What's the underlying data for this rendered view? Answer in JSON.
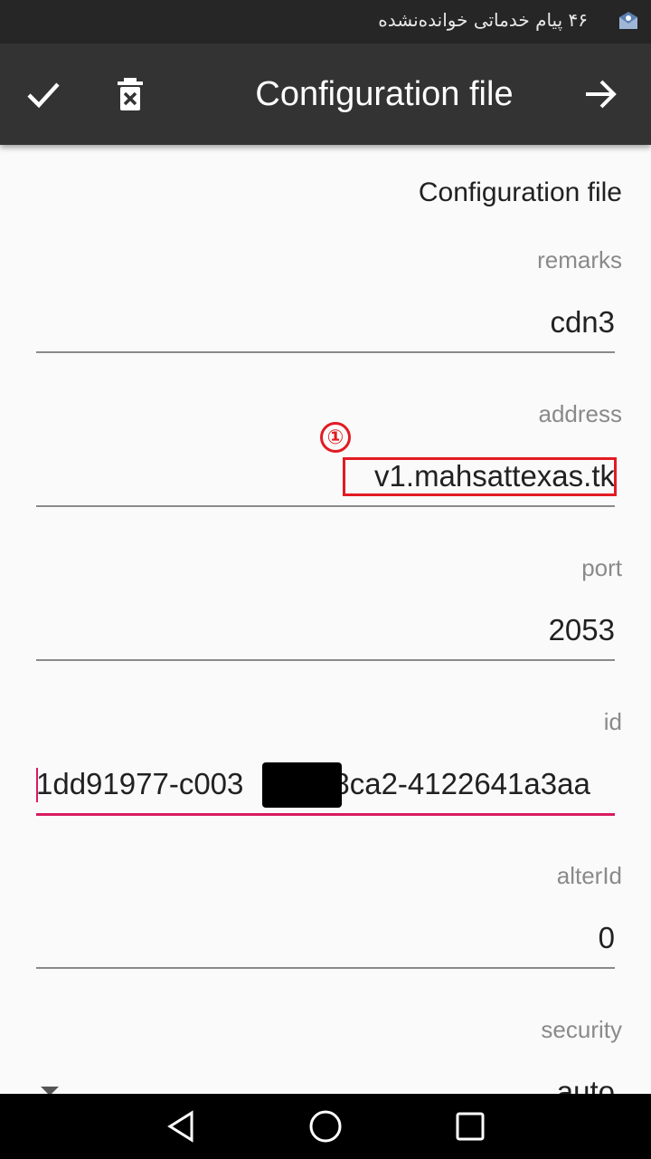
{
  "status_bar": {
    "notification_text": "۴۶ پیام خدماتی خوانده‌نشده",
    "icon": "mail-notification-icon"
  },
  "toolbar": {
    "title": "Configuration file",
    "confirm_icon": "check-icon",
    "delete_icon": "delete-icon",
    "forward_icon": "arrow-right-icon"
  },
  "form": {
    "section_title": "Configuration file",
    "fields": {
      "remarks": {
        "label": "remarks",
        "value": "cdn3"
      },
      "address": {
        "label": "address",
        "value": "v1.mahsattexas.tk"
      },
      "port": {
        "label": "port",
        "value": "2053"
      },
      "id": {
        "label": "id",
        "value": "1dd91977-c003",
        "value_after_redaction": "-8ca2-4122641a3aa"
      },
      "alterId": {
        "label": "alterId",
        "value": "0"
      },
      "security": {
        "label": "security",
        "value": "auto"
      }
    }
  },
  "annotation": {
    "marker": "①",
    "color": "#e21b23"
  },
  "colors": {
    "toolbar": "#333333",
    "status_bar": "#262626",
    "accent": "#d81b60",
    "background": "#fafafa"
  },
  "nav_bar": {
    "back_icon": "back-triangle-icon",
    "home_icon": "home-circle-icon",
    "recents_icon": "recents-square-icon"
  }
}
